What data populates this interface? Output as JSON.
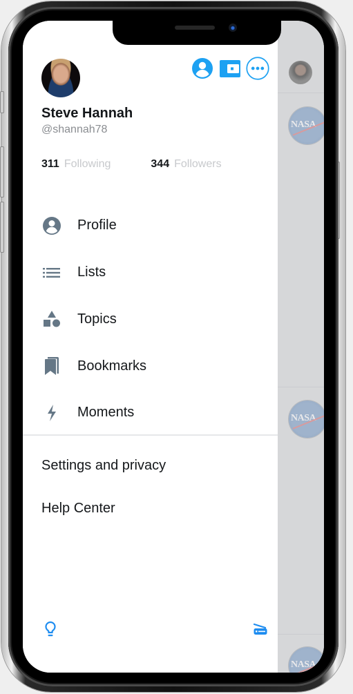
{
  "device": {
    "model": "phone-frame"
  },
  "drawer": {
    "user": {
      "name": "Steve Hannah",
      "handle": "@shannah78",
      "following_count": "311",
      "following_label": "Following",
      "followers_count": "344",
      "followers_label": "Followers"
    },
    "header_icons": [
      {
        "name": "account-icon"
      },
      {
        "name": "wallet-icon"
      },
      {
        "name": "more-options-icon"
      }
    ],
    "menu": [
      {
        "label": "Profile",
        "icon": "profile-icon"
      },
      {
        "label": "Lists",
        "icon": "lists-icon"
      },
      {
        "label": "Topics",
        "icon": "topics-icon"
      },
      {
        "label": "Bookmarks",
        "icon": "bookmarks-icon"
      },
      {
        "label": "Moments",
        "icon": "moments-icon"
      }
    ],
    "secondary": [
      {
        "label": "Settings and privacy"
      },
      {
        "label": "Help Center"
      }
    ],
    "footer": {
      "left_icon": "lightbulb-icon",
      "right_icon": "qr-scan-icon"
    }
  },
  "timeline": {
    "avatars": [
      "user-avatar",
      "nasa-avatar",
      "nasa-avatar",
      "nasa-avatar"
    ],
    "nasa_text": "NASA"
  },
  "colors": {
    "accent": "#1da1f2",
    "icon_gray": "#657786",
    "text": "#14171a",
    "muted": "#c7c9cc"
  }
}
